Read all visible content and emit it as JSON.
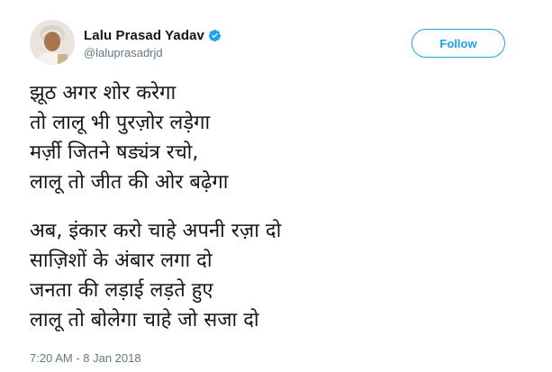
{
  "tweet": {
    "author": {
      "display_name": "Lalu Prasad Yadav",
      "handle": "@laluprasadrjd",
      "verified": true
    },
    "follow_label": "Follow",
    "stanza1": [
      "झूठ अगर शोर करेगा",
      "तो लालू भी पुरज़ोर लड़ेगा",
      "मर्ज़ी जितने षड्यंत्र रचो,",
      "लालू तो जीत की ओर बढ़ेगा"
    ],
    "stanza2": [
      "अब, इंकार करो चाहे अपनी रज़ा दो",
      "साज़िशों के अंबार लगा दो",
      "जनता की लड़ाई लड़ते हुए",
      "लालू तो बोलेगा चाहे जो सजा दो"
    ],
    "timestamp": "7:20 AM - 8 Jan 2018"
  },
  "colors": {
    "accent": "#1da1f2",
    "text_primary": "#14171a",
    "text_secondary": "#657786",
    "background": "#ffffff"
  },
  "icons": {
    "verified": "verified-badge-icon"
  }
}
